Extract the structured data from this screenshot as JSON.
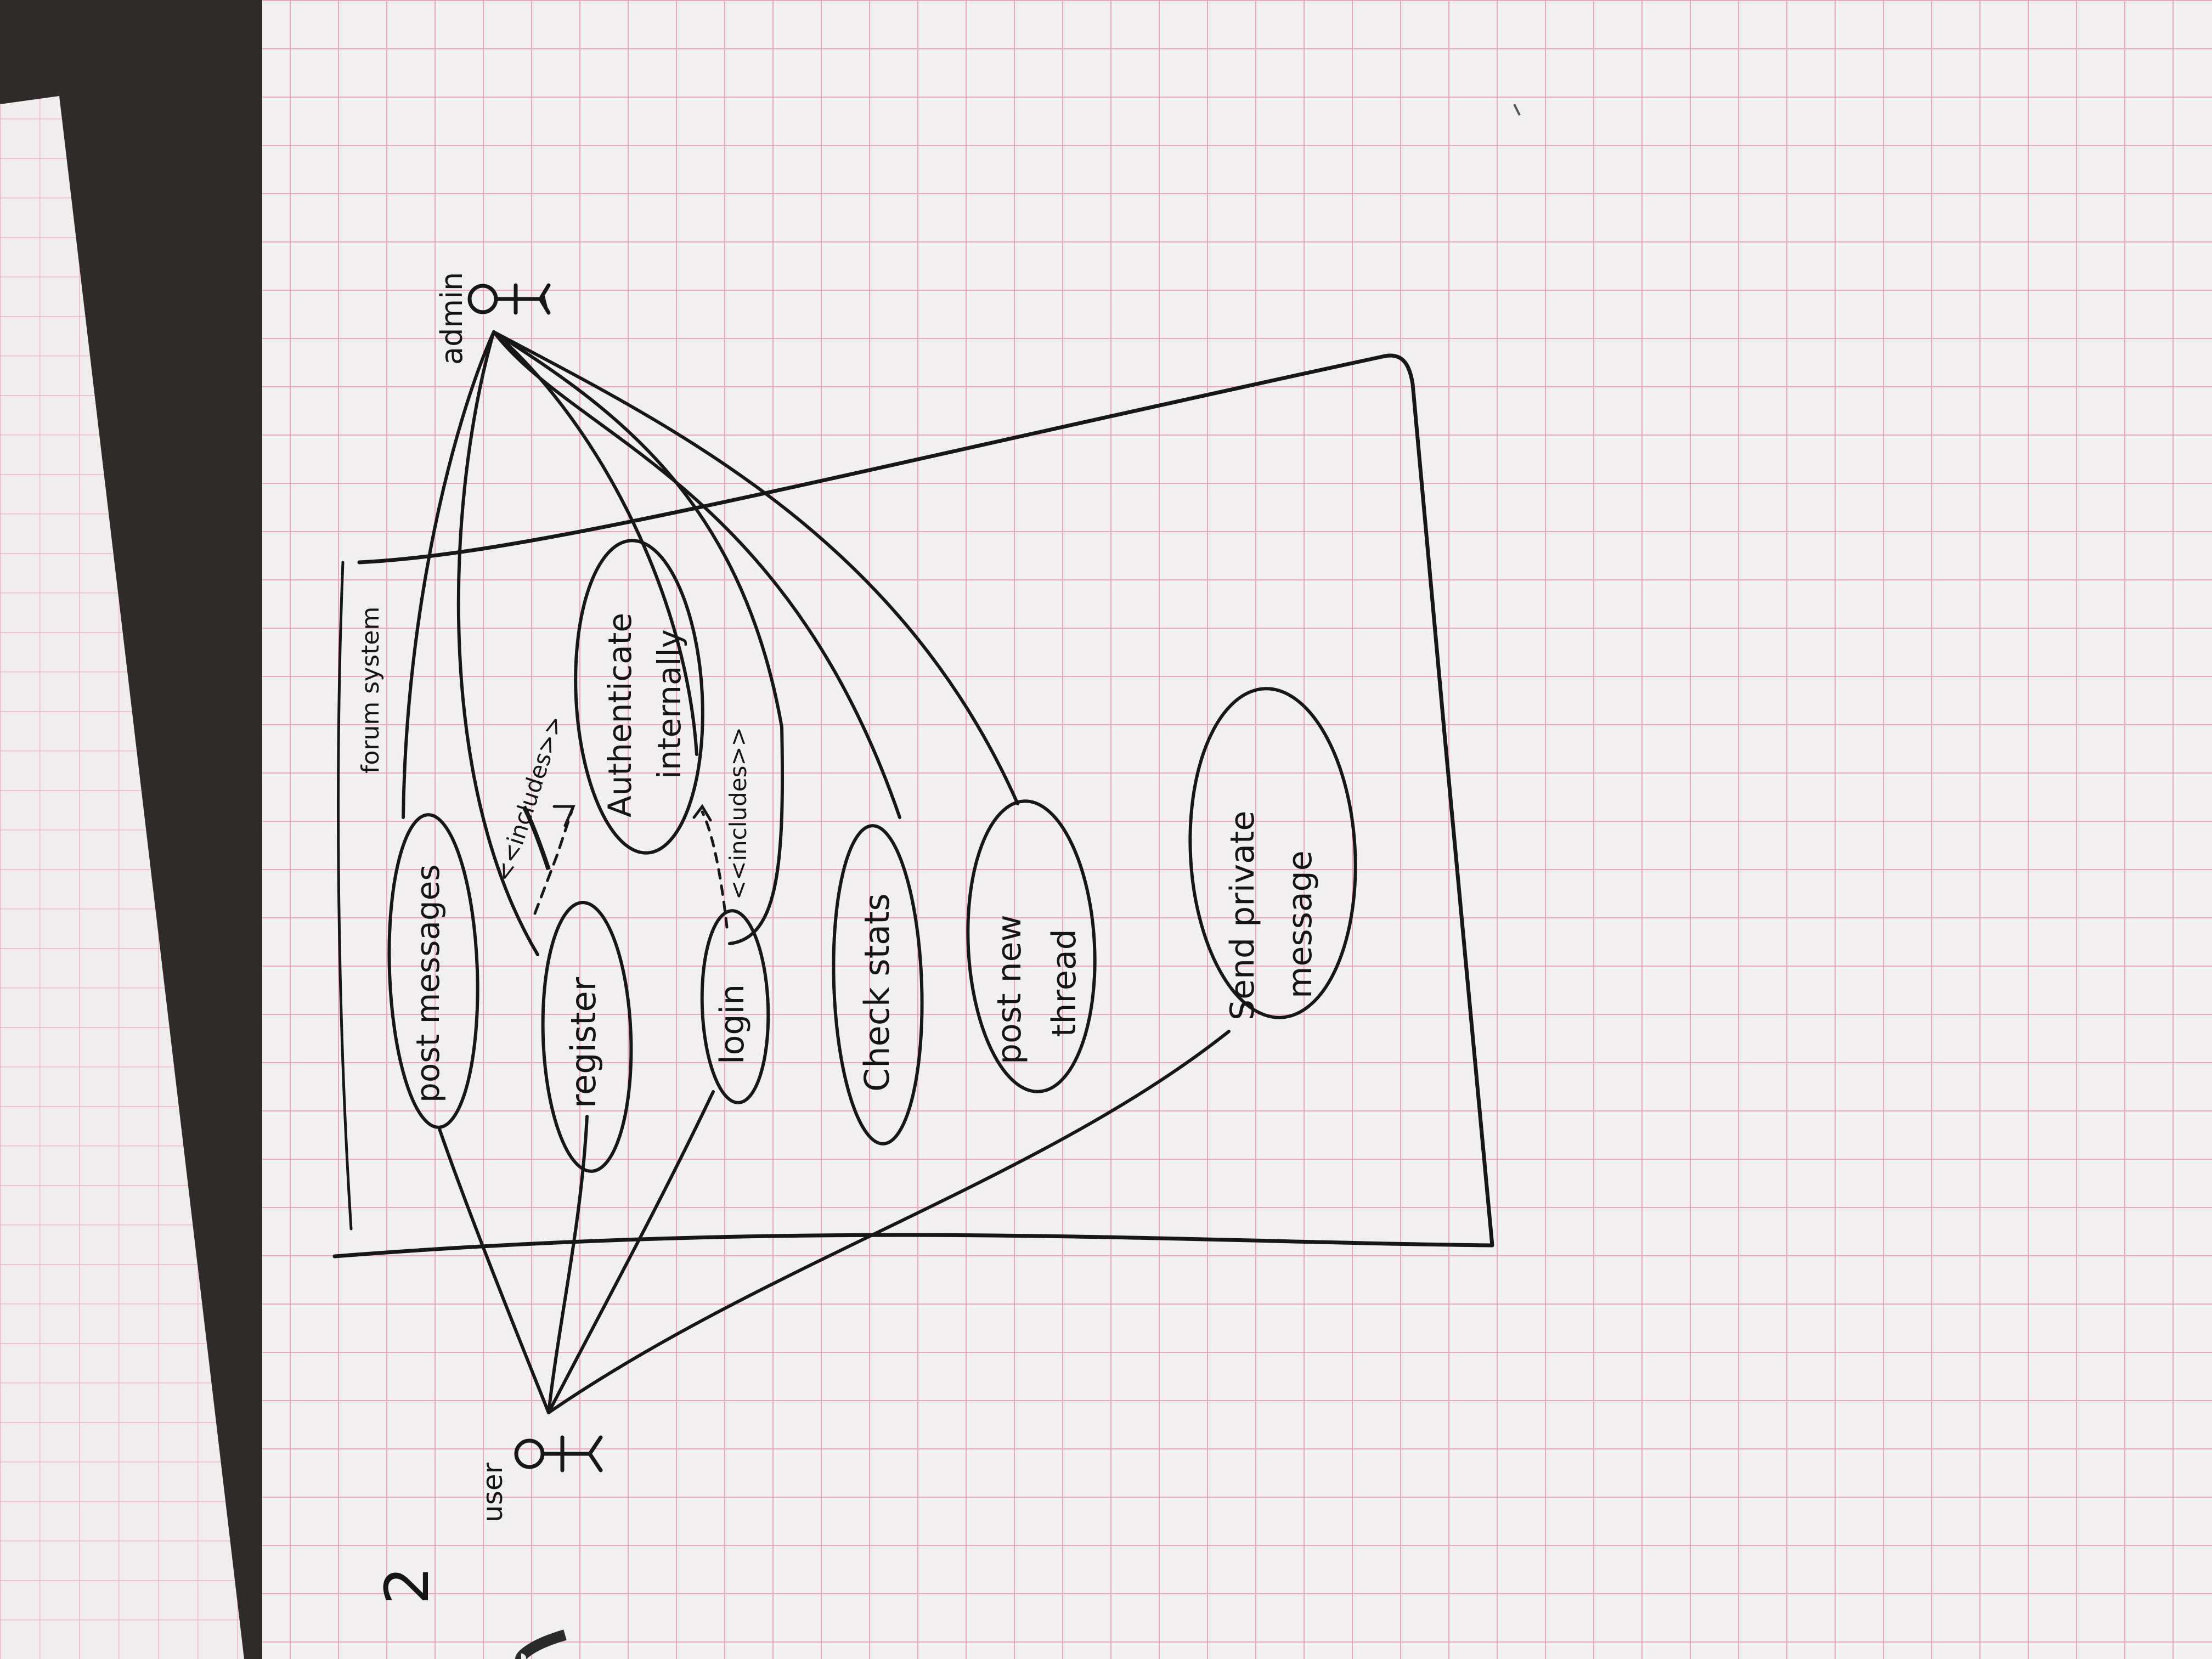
{
  "diagram": {
    "page_number": "2",
    "system_boundary_label": "forum system",
    "actors": {
      "user": {
        "label": "user",
        "icon": "stick-figure-icon"
      },
      "admin": {
        "label": "admin",
        "icon": "stick-figure-icon"
      }
    },
    "use_cases": {
      "post_messages": "post messages",
      "register": "register",
      "login": "login",
      "authenticate_line1": "Authenticate",
      "authenticate_line2": "internally",
      "check_stats": "Check stats",
      "post_new_thread_line1": "post new",
      "post_new_thread_line2": "thread",
      "send_private_message_line1": "Send private",
      "send_private_message_line2": "message"
    },
    "relations": {
      "register_includes": "<<includes>>",
      "login_includes": "<<includes>>"
    },
    "colors": {
      "ink": "#151515",
      "grid": "#e9a9b9",
      "paper": "#f1eff0",
      "background": "#2f2b28"
    }
  }
}
